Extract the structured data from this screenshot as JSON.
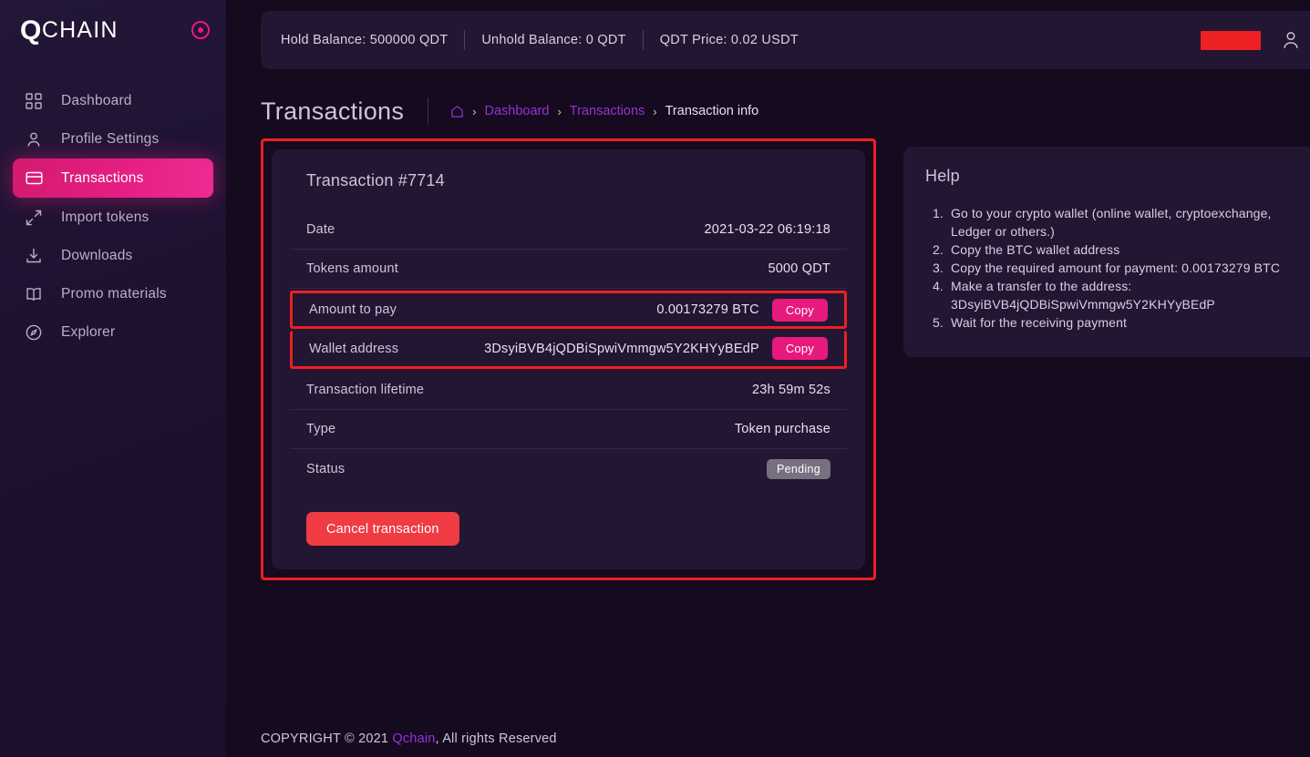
{
  "brand": {
    "logo_q": "Q",
    "logo_rest": "CHAIN",
    "accent_pink": "#e8197d",
    "accent_purple": "#9333d8",
    "annotation_red": "#ee1f24"
  },
  "sidebar": {
    "items": [
      {
        "label": "Dashboard",
        "icon": "grid-icon",
        "active": false
      },
      {
        "label": "Profile Settings",
        "icon": "person-icon",
        "active": false
      },
      {
        "label": "Transactions",
        "icon": "card-icon",
        "active": true
      },
      {
        "label": "Import tokens",
        "icon": "expand-arrows-icon",
        "active": false
      },
      {
        "label": "Downloads",
        "icon": "download-icon",
        "active": false
      },
      {
        "label": "Promo materials",
        "icon": "book-icon",
        "active": false
      },
      {
        "label": "Explorer",
        "icon": "compass-icon",
        "active": false
      }
    ]
  },
  "topbar": {
    "hold_balance": "Hold Balance: 500000 QDT",
    "unhold_balance": "Unhold Balance: 0 QDT",
    "qdt_price": "QDT Price: 0.02 USDT",
    "redaction": "",
    "user_icon": "user-icon"
  },
  "page": {
    "title": "Transactions",
    "breadcrumb": {
      "home_icon": "home-icon",
      "items": [
        "Dashboard",
        "Transactions",
        "Transaction info"
      ],
      "separator": "›"
    }
  },
  "transaction": {
    "card_title": "Transaction #7714",
    "rows": [
      {
        "key": "Date",
        "value": "2021-03-22 06:19:18",
        "copy": false,
        "highlight": false
      },
      {
        "key": "Tokens amount",
        "value": "5000 QDT",
        "copy": false,
        "highlight": false
      },
      {
        "key": "Amount to pay",
        "value": "0.00173279 BTC",
        "copy": true,
        "highlight": true
      },
      {
        "key": "Wallet address",
        "value": "3DsyiBVB4jQDBiSpwiVmmgw5Y2KHYyBEdP",
        "copy": true,
        "highlight": true
      },
      {
        "key": "Transaction lifetime",
        "value": "23h 59m 52s",
        "copy": false,
        "highlight": false
      },
      {
        "key": "Type",
        "value": "Token purchase",
        "copy": false,
        "highlight": false
      }
    ],
    "status_label": "Status",
    "status_value": "Pending",
    "copy_label": "Copy",
    "cancel_label": "Cancel transaction"
  },
  "help": {
    "title": "Help",
    "steps": [
      "Go to your crypto wallet (online wallet, cryptoexchange, Ledger or others.)",
      "Copy the BTC wallet address",
      "Copy the required amount for payment: 0.00173279 BTC",
      "Make a transfer to the address: 3DsyiBVB4jQDBiSpwiVmmgw5Y2KHYyBEdP",
      "Wait for the receiving payment"
    ]
  },
  "footer": {
    "prefix": "COPYRIGHT © 2021",
    "link": "Qchain",
    "suffix": ", All rights Reserved"
  }
}
